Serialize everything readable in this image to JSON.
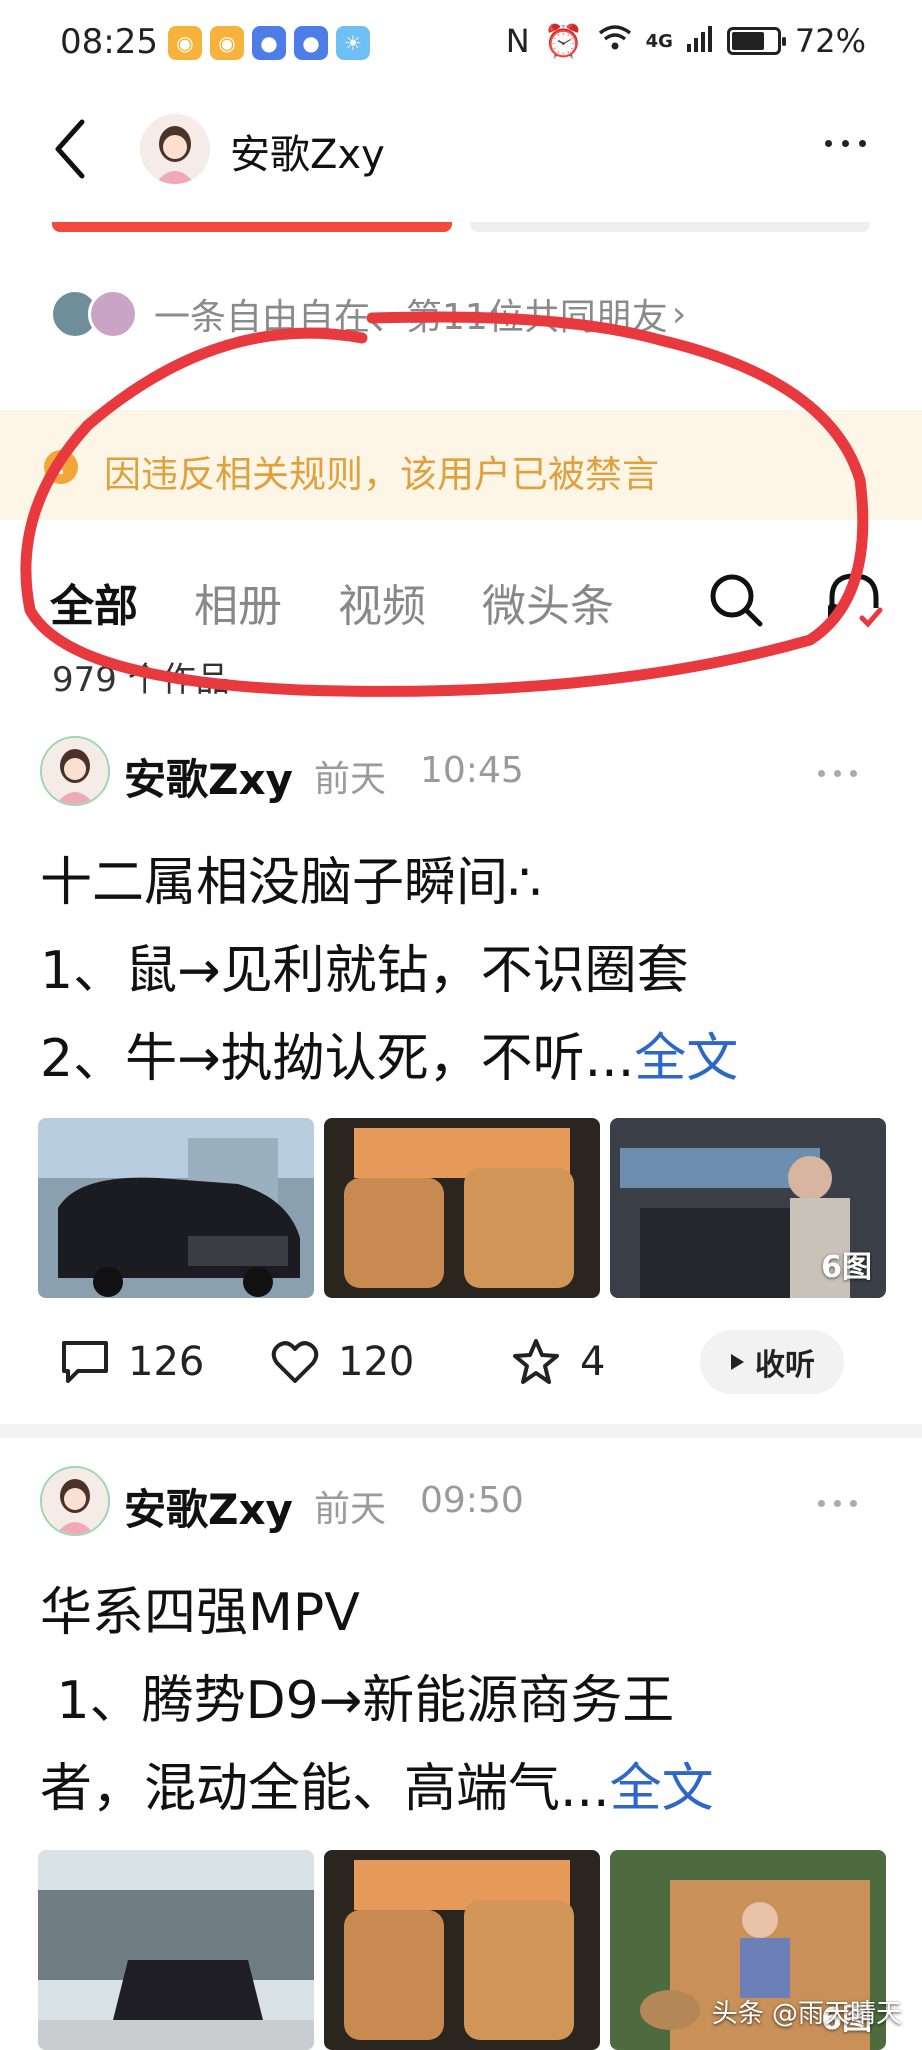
{
  "status": {
    "time": "08:25",
    "network": "4G",
    "battery": "72%",
    "battery_level": 0.72
  },
  "header": {
    "title": "安歌Zxy"
  },
  "friends": {
    "text": "一条自由自在、第11位共同朋友",
    "chevron": "›"
  },
  "ban_notice": {
    "icon": "!",
    "text": "因违反相关规则，该用户已被禁言"
  },
  "tabs": [
    {
      "label": "全部"
    },
    {
      "label": "相册"
    },
    {
      "label": "视频"
    },
    {
      "label": "微头条"
    }
  ],
  "works_count": "979 个作品",
  "posts": [
    {
      "author": "安歌Zxy",
      "date": "前天",
      "time": "10:45",
      "lines": [
        "十二属相没脑子瞬间∴",
        "1、鼠→见利就钻，不识圈套",
        "2、牛→执拗认死，不听..."
      ],
      "readmore": "全文",
      "image_count": "6图",
      "comments": "126",
      "likes": "120",
      "favorites": "4",
      "listen": "收听"
    },
    {
      "author": "安歌Zxy",
      "date": "前天",
      "time": "09:50",
      "lines": [
        "华系四强MPV",
        " 1、腾势D9→新能源商务王",
        "者，混动全能、高端气..."
      ],
      "readmore": "全文",
      "image_count": "6图"
    }
  ],
  "watermark": "头条 @雨天晴天",
  "colors": {
    "accent_red": "#f24a3d",
    "warning_bg": "#fdf6e7",
    "warning_text": "#e0a13d",
    "link_blue": "#2d67c9",
    "annotation_red": "#e8393f"
  }
}
